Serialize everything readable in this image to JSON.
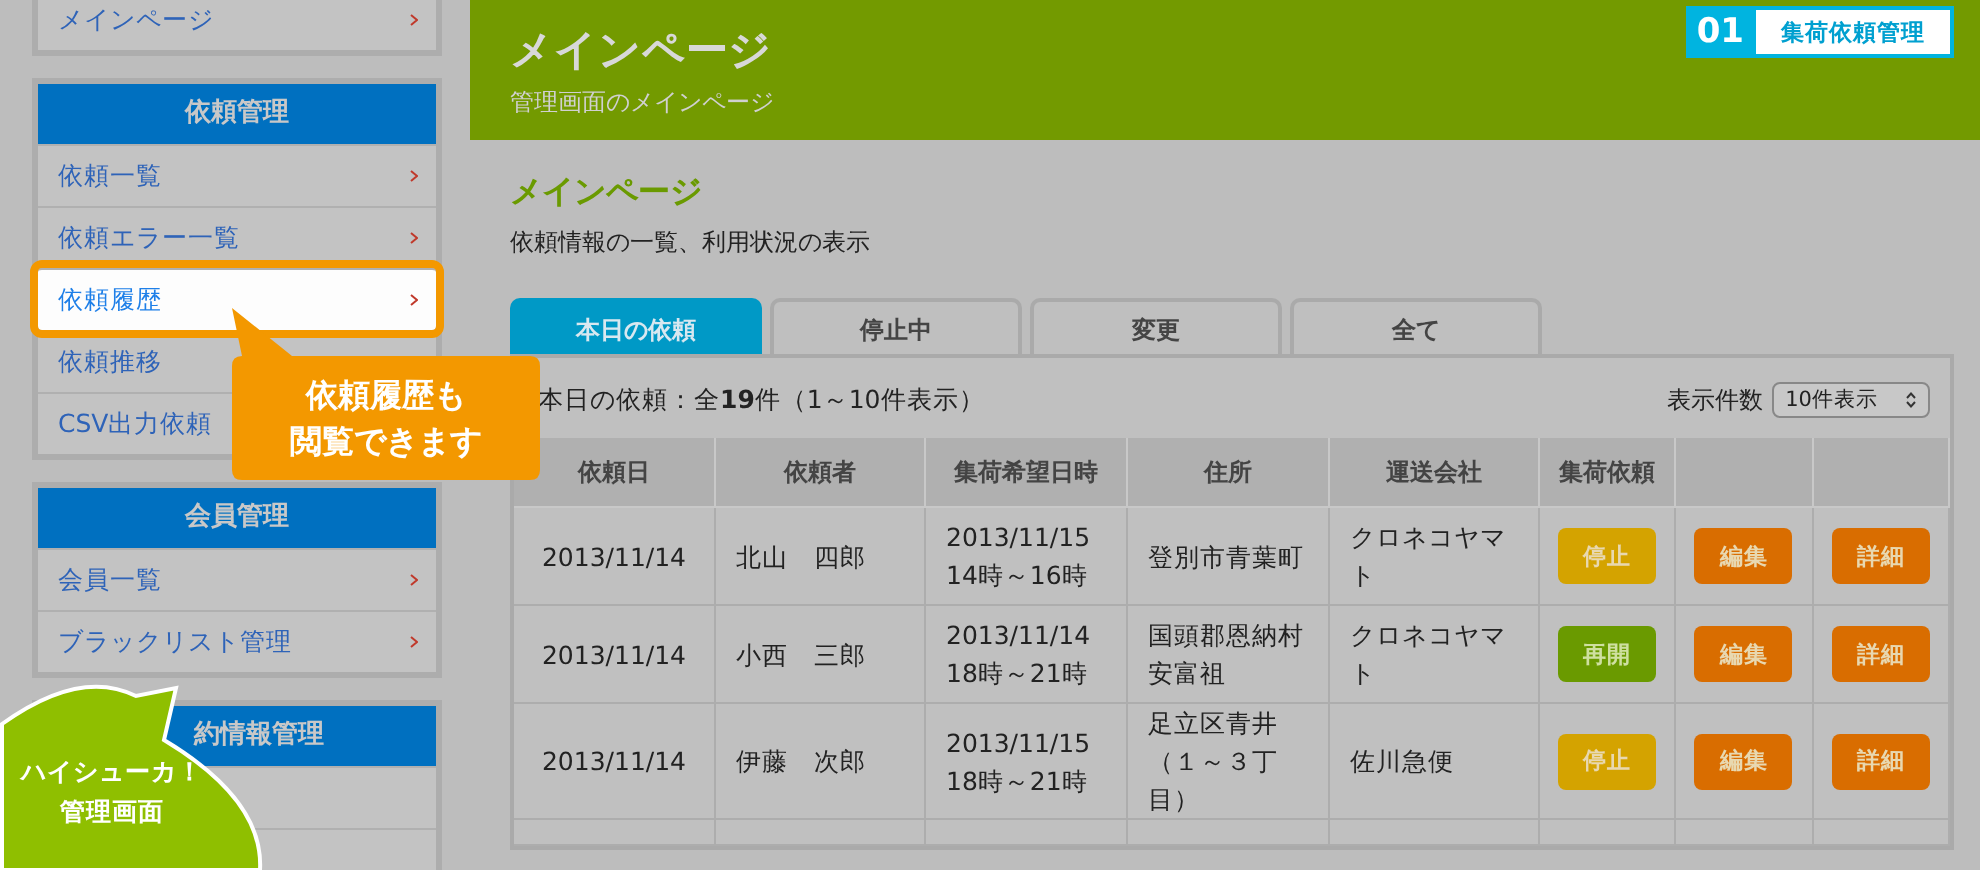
{
  "sidebar": {
    "groups": [
      {
        "items": [
          {
            "label": "メインページ",
            "highlighted": false
          }
        ]
      },
      {
        "title": "依頼管理",
        "items": [
          {
            "label": "依頼一覧",
            "highlighted": false
          },
          {
            "label": "依頼エラー一覧",
            "highlighted": false
          },
          {
            "label": "依頼履歴",
            "highlighted": true
          },
          {
            "label": "依頼推移",
            "highlighted": false
          },
          {
            "label": "CSV出力依頼",
            "highlighted": false
          }
        ]
      },
      {
        "title": "会員管理",
        "items": [
          {
            "label": "会員一覧",
            "highlighted": false
          },
          {
            "label": "ブラックリスト管理",
            "highlighted": false
          }
        ]
      },
      {
        "title": "約情報管理",
        "items": [
          {
            "highlighted": false
          },
          {
            "highlighted": false
          }
        ]
      }
    ]
  },
  "header": {
    "title": "メインページ",
    "subtitle": "管理画面のメインページ",
    "badge_number": "01",
    "badge_label": "集荷依頼管理"
  },
  "section": {
    "title": "メインページ",
    "description": "依頼情報の一覧、利用状況の表示"
  },
  "tabs": [
    {
      "label": "本日の依頼",
      "selected": true
    },
    {
      "label": "停止中",
      "selected": false
    },
    {
      "label": "変更",
      "selected": false
    },
    {
      "label": "全て",
      "selected": false
    }
  ],
  "summary": "本日の依頼：全**19**件（1～10件表示）",
  "page_size": {
    "label": "表示件数",
    "value": "10件表示"
  },
  "table": {
    "columns": [
      "依頼日",
      "依頼者",
      "集荷希望日時",
      "住所",
      "運送会社",
      "集荷依頼",
      "",
      ""
    ],
    "rows": [
      {
        "date": "2013/11/14",
        "requester": "北山　四郎",
        "pickup": "2013/11/15\n14時～16時",
        "address": "登別市青葉町",
        "carrier": "クロネコヤマト",
        "status_button": {
          "label": "停止",
          "kind": "stop"
        },
        "edit_button": {
          "label": "編集",
          "kind": "edit"
        },
        "detail_button": {
          "label": "詳細",
          "kind": "edit"
        }
      },
      {
        "date": "2013/11/14",
        "requester": "小西　三郎",
        "pickup": "2013/11/14\n18時～21時",
        "address": "国頭郡恩納村安富祖",
        "carrier": "クロネコヤマト",
        "status_button": {
          "label": "再開",
          "kind": "resume"
        },
        "edit_button": {
          "label": "編集",
          "kind": "edit"
        },
        "detail_button": {
          "label": "詳細",
          "kind": "edit"
        }
      },
      {
        "date": "2013/11/14",
        "requester": "伊藤　次郎",
        "pickup": "2013/11/15\n18時～21時",
        "address": "足立区青井（１～３丁目）",
        "carrier": "佐川急便",
        "status_button": {
          "label": "停止",
          "kind": "stop"
        },
        "edit_button": {
          "label": "編集",
          "kind": "edit"
        },
        "detail_button": {
          "label": "詳細",
          "kind": "edit"
        }
      }
    ]
  },
  "callouts": {
    "tip": [
      "依頼履歴も",
      "閲覧できます"
    ],
    "mascot": [
      "ハイシューカ！",
      "管理画面"
    ]
  }
}
